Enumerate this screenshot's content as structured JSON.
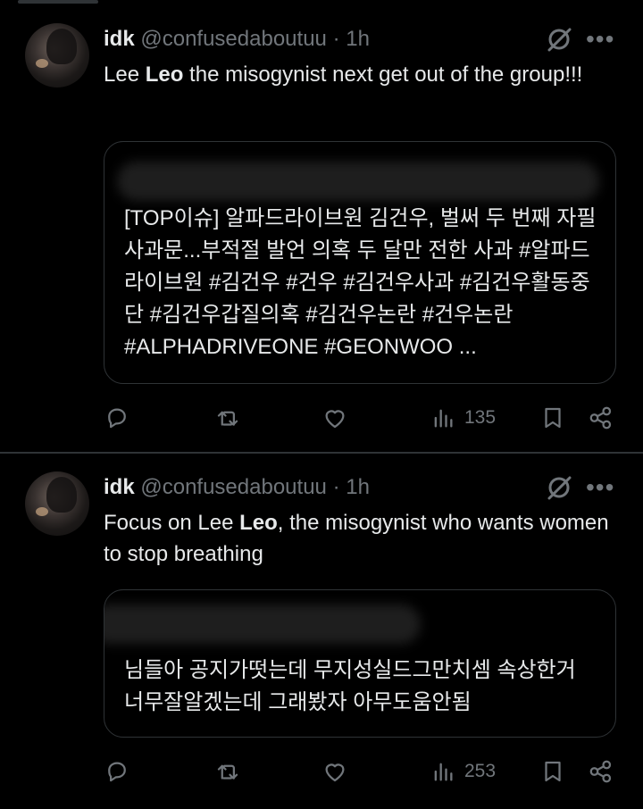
{
  "tweets": [
    {
      "name": "idk",
      "handle": "@confusedaboutuu",
      "dot": "·",
      "time": "1h",
      "text_before": "Lee ",
      "text_bold": "Leo",
      "text_after": " the misogynist next get out of the group!!!",
      "quote_text": "[TOP이슈] 알파드라이브원 김건우, 벌써 두 번째 자필 사과문...부적절 발언 의혹 두 달만 전한 사과 #알파드라이브원 #김건우 #건우 #김건우사과 #김건우활동중단 #김건우갑질의혹 #김건우논란 #건우논란 #ALPHADRIVEONE #GEONWOO ...",
      "views": "135"
    },
    {
      "name": "idk",
      "handle": "@confusedaboutuu",
      "dot": "·",
      "time": "1h",
      "text_before": "Focus on Lee ",
      "text_bold": "Leo",
      "text_after": ", the misogynist who wants women to stop breathing",
      "quote_text": "님들아 공지가떳는데 무지성실드그만치셈 속상한거 너무잘알겠는데 그래봤자 아무도움안됨",
      "views": "253"
    }
  ],
  "icons": {
    "more": "more-dots-icon",
    "grok": "grok-icon",
    "reply": "reply-icon",
    "retweet": "retweet-icon",
    "like": "heart-icon",
    "views": "views-chart-icon",
    "bookmark": "bookmark-icon",
    "share": "share-icon"
  },
  "colors": {
    "background": "#000000",
    "text": "#e7e9ea",
    "muted": "#71767b",
    "border": "#2f3336"
  }
}
